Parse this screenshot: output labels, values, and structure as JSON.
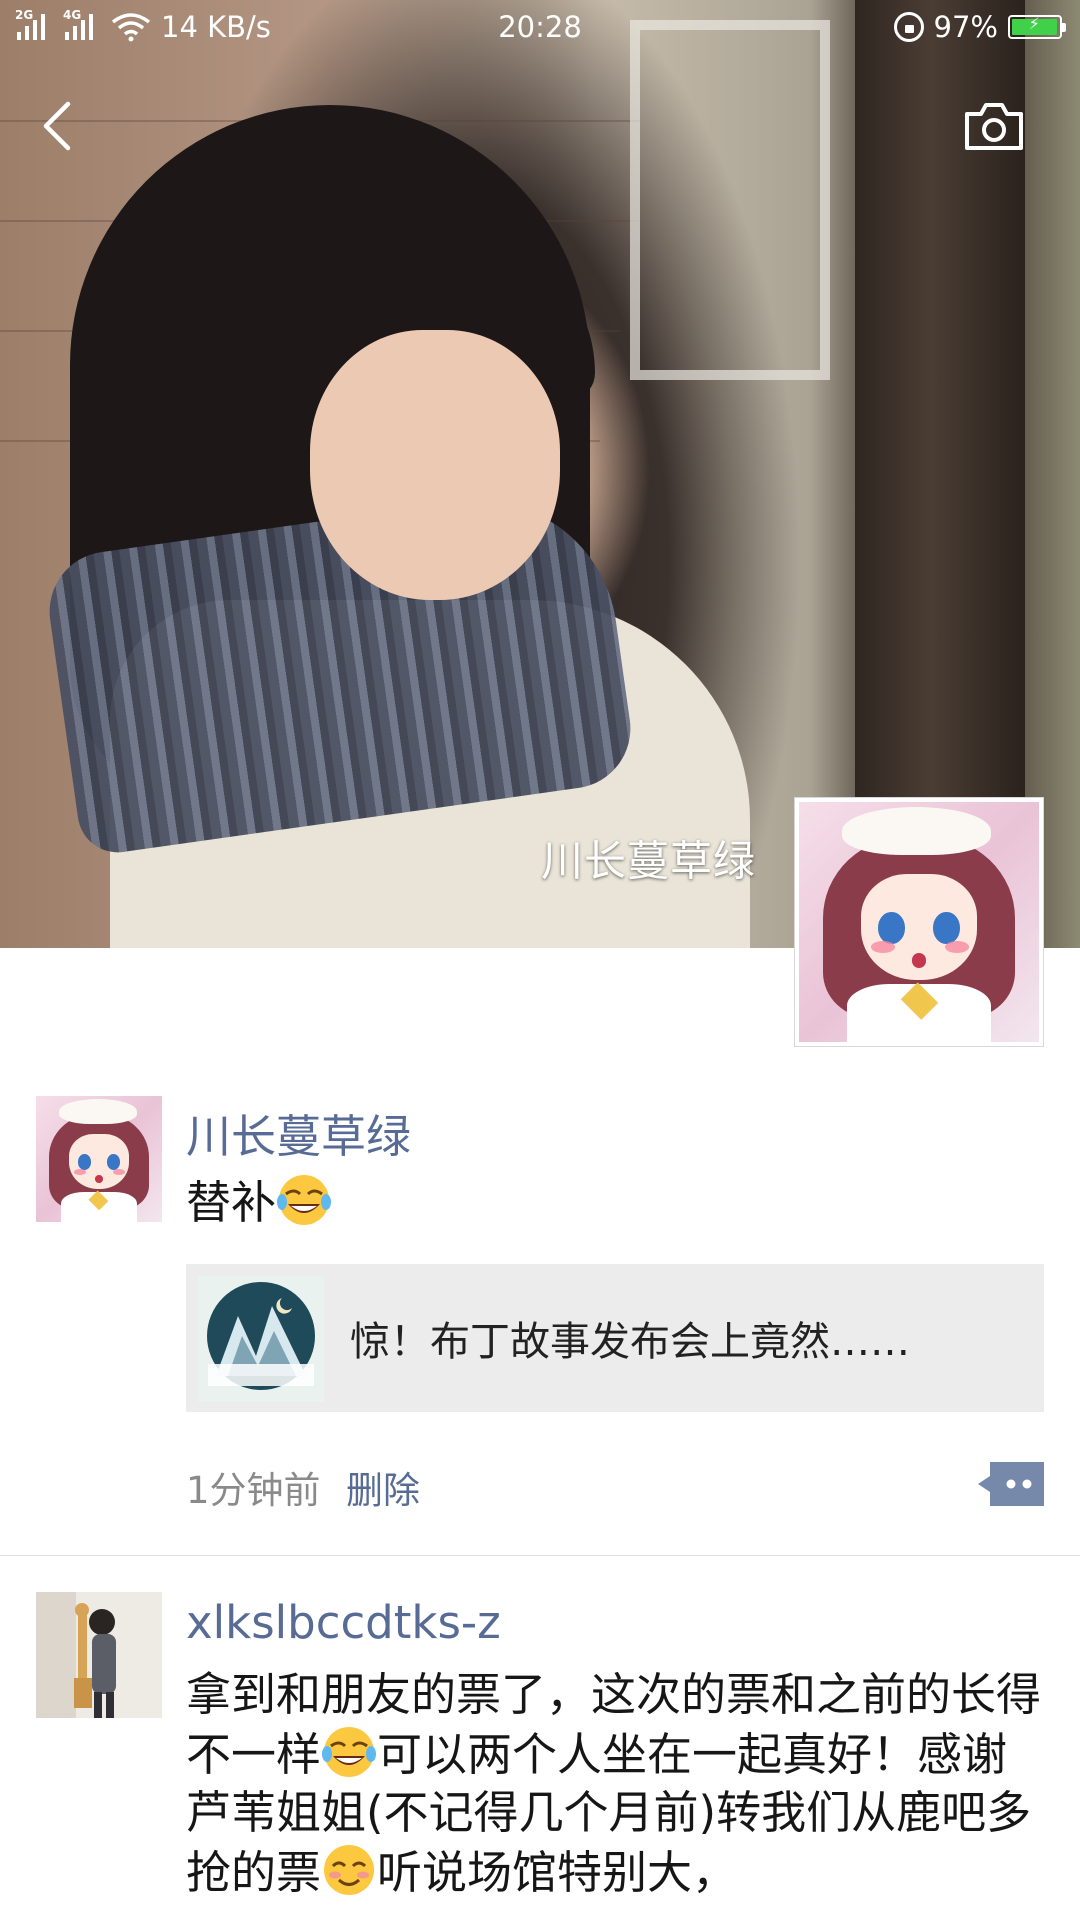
{
  "status_bar": {
    "signal_1_tag": "2G",
    "signal_2_tag": "4G",
    "network_speed": "14 KB/s",
    "time": "20:28",
    "battery_percent": "97%",
    "battery_level": 0.97,
    "battery_color": "#40d04a"
  },
  "nav": {
    "back_icon": "chevron-left-icon",
    "camera_icon": "camera-icon"
  },
  "profile": {
    "cover_name": "川长蔓草绿"
  },
  "posts": [
    {
      "username": "川长蔓草绿",
      "text": "替补",
      "text_emoji": "tears-of-joy-emoji",
      "link_card": {
        "title": "惊！布丁故事发布会上竟然……"
      },
      "time": "1分钟前",
      "delete_label": "删除",
      "more_icon": "comment-more-icon"
    },
    {
      "username": "xlkslbccdtks-z",
      "text_part_1": "拿到和朋友的票了，这次的票和之前的长得不一样",
      "text_part_2": "可以两个人坐在一起真好！感谢芦苇姐姐(不记得几个月前)转我们从鹿吧多抢的票",
      "text_part_3": "听说场馆特别大，"
    }
  ],
  "colors": {
    "link_blue": "#576b95",
    "card_bg": "#ececec",
    "meta_gray": "#8a8a8a"
  }
}
